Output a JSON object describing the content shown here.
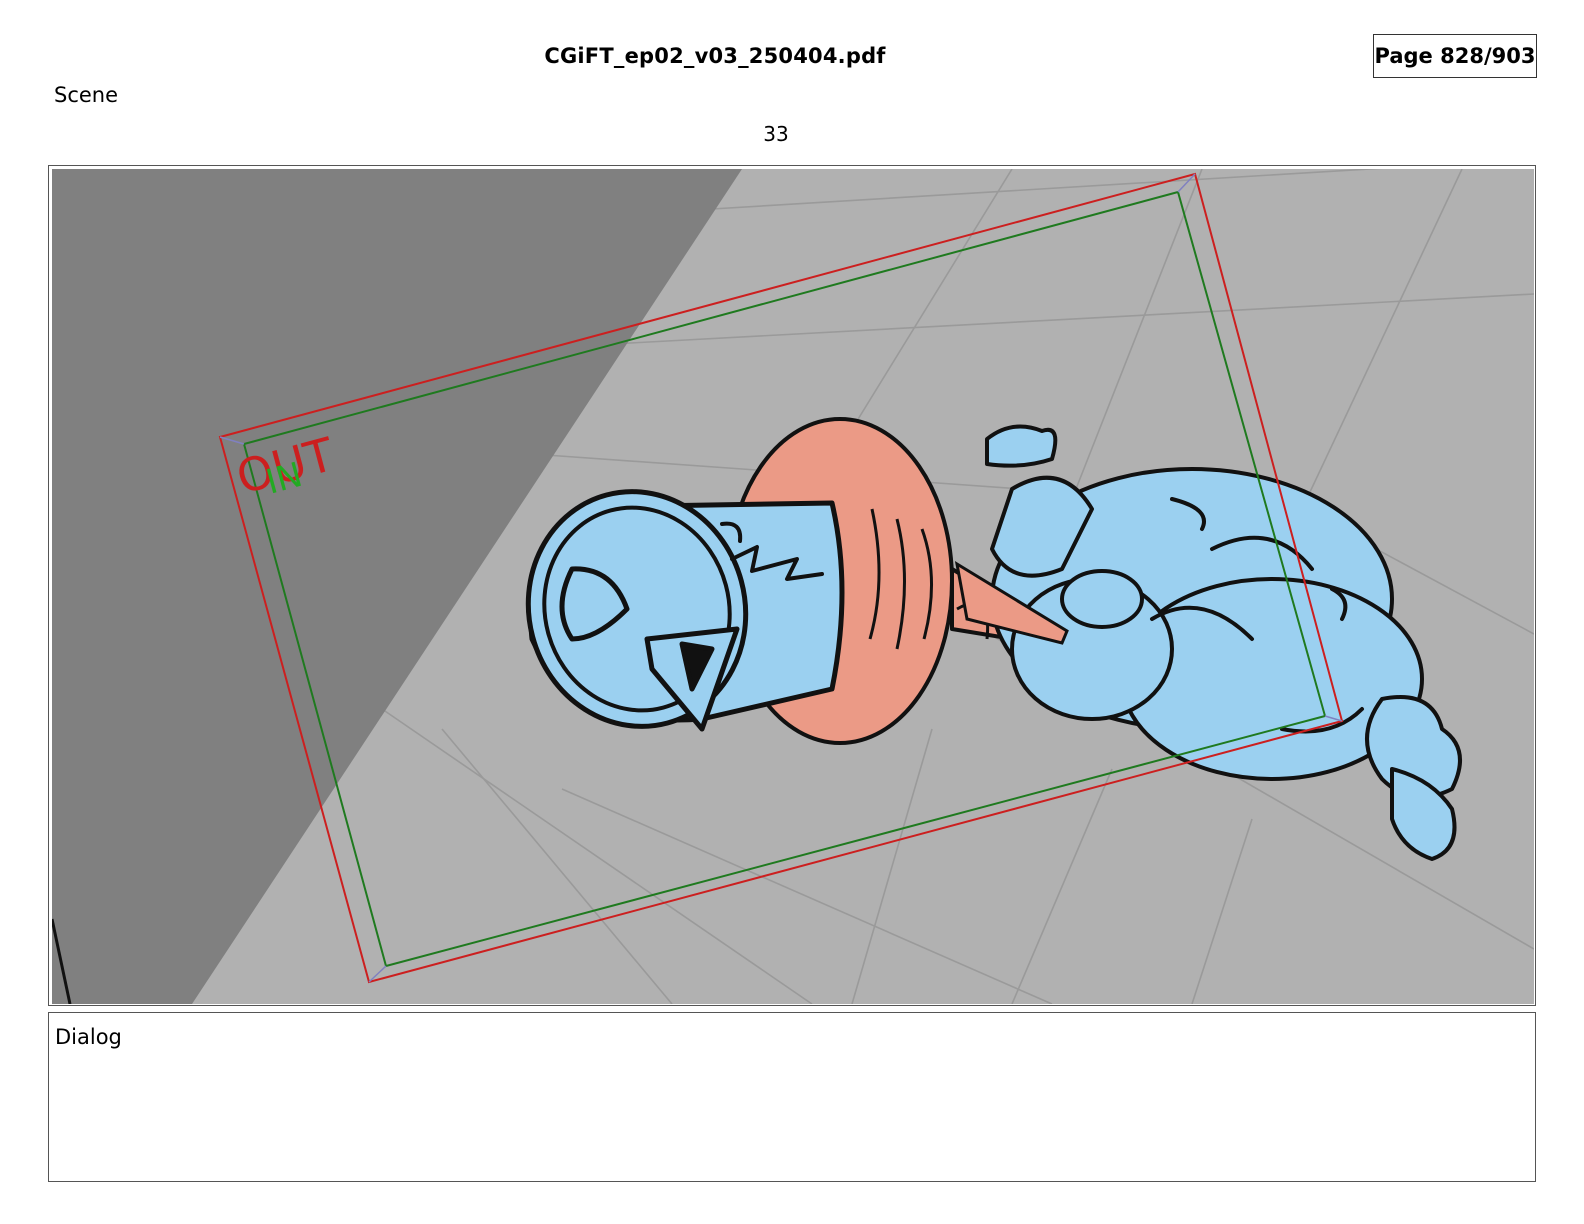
{
  "document": {
    "title": "CGiFT_ep02_v03_250404.pdf",
    "page_label": "Page 828/903"
  },
  "scene": {
    "label": "Scene",
    "number": "33"
  },
  "panel": {
    "frame_out_label": "OUT",
    "frame_in_label": "IN",
    "colors": {
      "floor": "#b1b1b1",
      "wall_shadow": "#808080",
      "out_frame": "#cc1f1f",
      "in_frame": "#1f7a1f",
      "character_blue": "#9bd0f0",
      "saucer_salmon": "#eb9a86",
      "ink": "#111111"
    }
  },
  "dialog": {
    "label": "Dialog"
  }
}
